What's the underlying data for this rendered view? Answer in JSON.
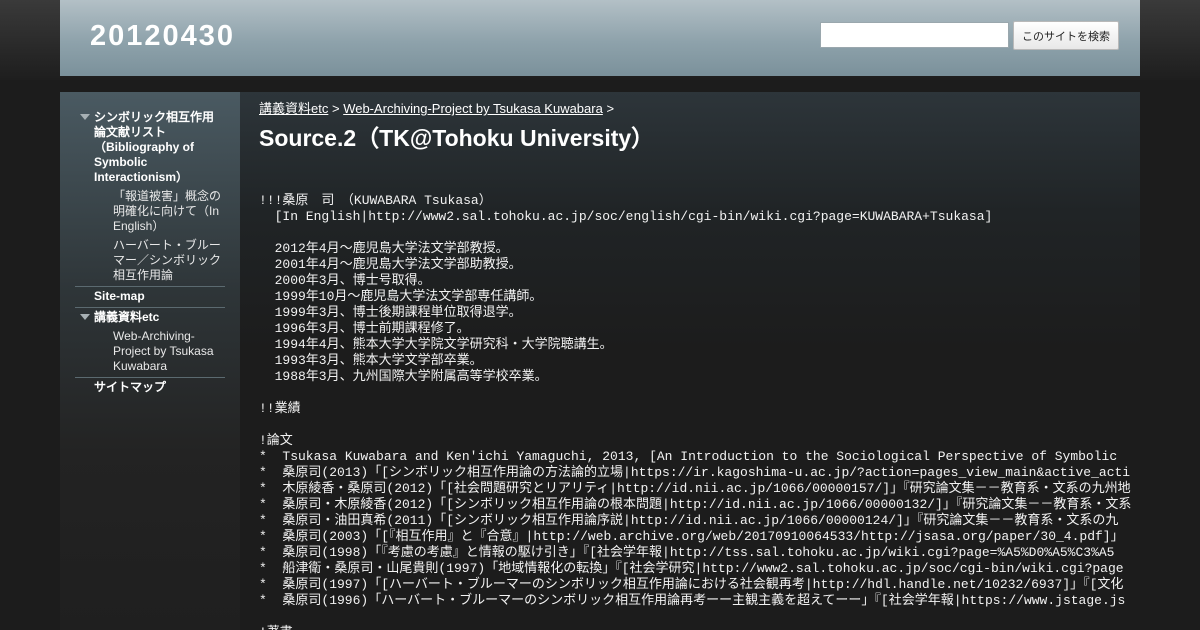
{
  "header": {
    "site_title": "20120430",
    "search_placeholder": "",
    "search_button_label": "このサイトを検索"
  },
  "sidebar": {
    "groups": [
      {
        "label": "シンボリック相互作用論文献リスト（Bibliography of Symbolic Interactionism）",
        "expanded": true,
        "children": [
          "「報道被害」概念の明確化に向けて（In English）",
          "ハーバート・ブルーマー／シンボリック相互作用論"
        ]
      },
      {
        "label": "Site-map",
        "expanded": false,
        "children": []
      },
      {
        "label": "講義資料etc",
        "expanded": true,
        "children": [
          "Web-Archiving-Project by Tsukasa Kuwabara"
        ]
      },
      {
        "label": "サイトマップ",
        "expanded": false,
        "children": []
      }
    ]
  },
  "breadcrumb": {
    "items": [
      "講義資料etc",
      "Web-Archiving-Project by Tsukasa Kuwabara"
    ],
    "separator": ">"
  },
  "page": {
    "title": "Source.2（TK@Tohoku University）",
    "lines": [
      "!!!桑原　司　（KUWABARA Tsukasa）",
      "  [In English|http://www2.sal.tohoku.ac.jp/soc/english/cgi-bin/wiki.cgi?page=KUWABARA+Tsukasa]",
      "",
      "  2012年4月～鹿児島大学法文学部教授。",
      "  2001年4月～鹿児島大学法文学部助教授。",
      "  2000年3月、博士号取得。",
      "  1999年10月～鹿児島大学法文学部専任講師。",
      "  1999年3月、博士後期課程単位取得退学。",
      "  1996年3月、博士前期課程修了。",
      "  1994年4月、熊本大学大学院文学研究科・大学院聴講生。",
      "  1993年3月、熊本大学文学部卒業。",
      "  1988年3月、九州国際大学附属高等学校卒業。",
      "",
      "!!業績",
      "",
      "!論文",
      "*  Tsukasa Kuwabara and Ken'ichi Yamaguchi, 2013, [An Introduction to the Sociological Perspective of Symbolic",
      "*  桑原司(2013)「[シンボリック相互作用論の方法論的立場|https://ir.kagoshima-u.ac.jp/?action=pages_view_main&active_acti",
      "*  木原綾香・桑原司(2012)「[社会問題研究とリアリティ|http://id.nii.ac.jp/1066/00000157/]」『研究論文集－－教育系・文系の九州地",
      "*  桑原司・木原綾香(2012)「[シンボリック相互作用論の根本問題|http://id.nii.ac.jp/1066/00000132/]」『研究論文集－－教育系・文系",
      "*  桑原司・油田真希(2011)「[シンボリック相互作用論序説|http://id.nii.ac.jp/1066/00000124/]」『研究論文集－－教育系・文系の九",
      "*  桑原司(2003)「[『相互作用』と『合意』|http://web.archive.org/web/20170910064533/http://jsasa.org/paper/30_4.pdf]」",
      "*  桑原司(1998)「『考慮の考慮』と情報の駆け引き」『[社会学年報|http://tss.sal.tohoku.ac.jp/wiki.cgi?page=%A5%D0%A5%C3%A5",
      "*  船津衛・桑原司・山尾貴則(1997)「地域情報化の転換」『[社会学研究|http://www2.sal.tohoku.ac.jp/soc/cgi-bin/wiki.cgi?page",
      "*  桑原司(1997)「[ハーバート・ブルーマーのシンボリック相互作用論における社会観再考|http://hdl.handle.net/10232/6937]」『[文化",
      "*  桑原司(1996)「ハーバート・ブルーマーのシンボリック相互作用論再考ーー主観主義を超えてーー」『[社会学年報|https://www.jstage.js",
      "",
      "!著書"
    ]
  }
}
